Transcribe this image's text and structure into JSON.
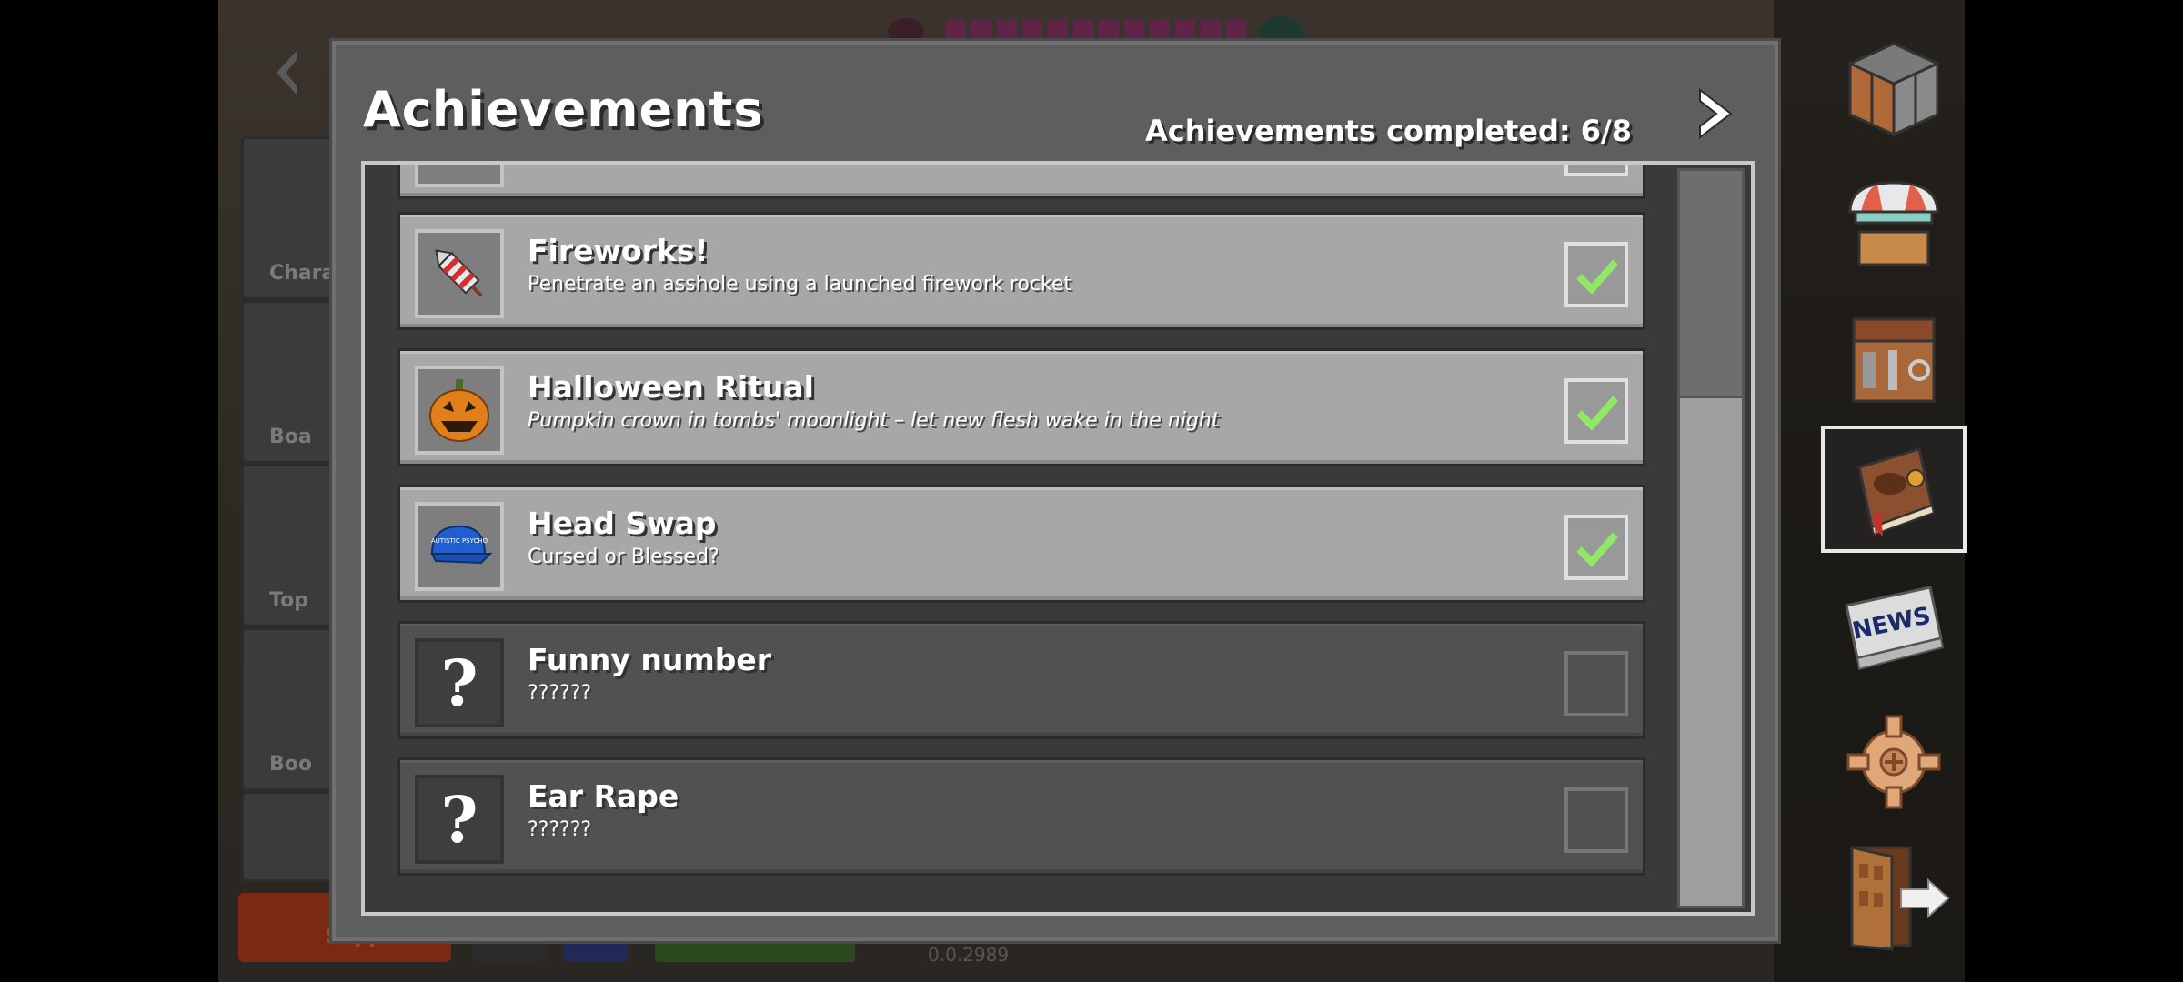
{
  "background": {
    "cards": [
      "Chara",
      "Boa",
      "Top",
      "Boo",
      ""
    ],
    "support_label": "Support",
    "version": "0.0.2989"
  },
  "modal": {
    "title": "Achievements",
    "progress_text": "Achievements completed: 6/8"
  },
  "achievements": [
    {
      "title": "Fireworks!",
      "description": "Penetrate an asshole using a launched firework rocket",
      "completed": true,
      "icon": "firework-rocket-icon"
    },
    {
      "title": "Halloween Ritual",
      "description": "Pumpkin crown in tombs' moonlight – let new flesh wake in the night",
      "completed": true,
      "icon": "jack-o-lantern-icon"
    },
    {
      "title": "Head Swap",
      "description": "Cursed or Blessed?",
      "completed": true,
      "icon": "blue-cap-icon"
    },
    {
      "title": "Funny number",
      "description": "??????",
      "completed": false,
      "icon": "question-mark-icon"
    },
    {
      "title": "Ear Rape",
      "description": "??????",
      "completed": false,
      "icon": "question-mark-icon"
    }
  ],
  "cap_text": "AUTISTIC PSYCHO",
  "sidebar": [
    {
      "name": "crafting-cube-icon"
    },
    {
      "name": "shop-stall-icon"
    },
    {
      "name": "workbench-icon"
    },
    {
      "name": "achievements-book-icon",
      "active": true
    },
    {
      "name": "news-icon",
      "label": "NEWS"
    },
    {
      "name": "settings-gear-icon"
    },
    {
      "name": "exit-door-icon"
    }
  ],
  "colors": {
    "check_green": "#8fe866",
    "panel": "#5e5e5e",
    "row_done": "#a7a7a7",
    "row_locked": "#515151"
  }
}
